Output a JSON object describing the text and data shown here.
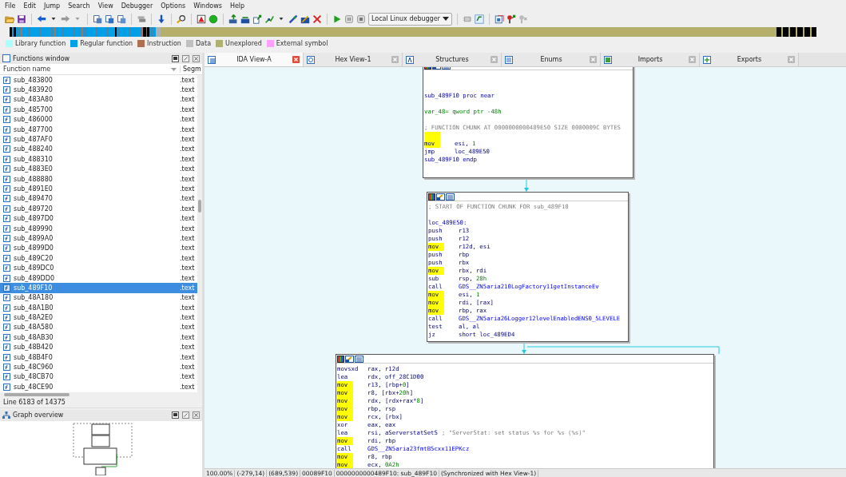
{
  "menu": [
    "File",
    "Edit",
    "Jump",
    "Search",
    "View",
    "Debugger",
    "Options",
    "Windows",
    "Help"
  ],
  "toolbar": {
    "debugger_select": "Local Linux debugger"
  },
  "legend": [
    {
      "label": "Library function",
      "color": "#aaffff"
    },
    {
      "label": "Regular function",
      "color": "#00a0e8"
    },
    {
      "label": "Instruction",
      "color": "#b07050"
    },
    {
      "label": "Data",
      "color": "#c0c0c0"
    },
    {
      "label": "Unexplored",
      "color": "#b0b070"
    },
    {
      "label": "External symbol",
      "color": "#ffa0ff"
    }
  ],
  "functions_window": {
    "title": "Functions window",
    "columns": [
      "Function name",
      "Segm"
    ],
    "rows": [
      {
        "name": "sub_483800",
        "segment": ".text",
        "selected": false
      },
      {
        "name": "sub_483920",
        "segment": ".text",
        "selected": false
      },
      {
        "name": "sub_483A80",
        "segment": ".text",
        "selected": false
      },
      {
        "name": "sub_485700",
        "segment": ".text",
        "selected": false
      },
      {
        "name": "sub_486000",
        "segment": ".text",
        "selected": false
      },
      {
        "name": "sub_487700",
        "segment": ".text",
        "selected": false
      },
      {
        "name": "sub_487AF0",
        "segment": ".text",
        "selected": false
      },
      {
        "name": "sub_488240",
        "segment": ".text",
        "selected": false
      },
      {
        "name": "sub_488310",
        "segment": ".text",
        "selected": false
      },
      {
        "name": "sub_4883E0",
        "segment": ".text",
        "selected": false
      },
      {
        "name": "sub_488880",
        "segment": ".text",
        "selected": false
      },
      {
        "name": "sub_4891E0",
        "segment": ".text",
        "selected": false
      },
      {
        "name": "sub_489470",
        "segment": ".text",
        "selected": false
      },
      {
        "name": "sub_489720",
        "segment": ".text",
        "selected": false
      },
      {
        "name": "sub_4897D0",
        "segment": ".text",
        "selected": false
      },
      {
        "name": "sub_489990",
        "segment": ".text",
        "selected": false
      },
      {
        "name": "sub_4899A0",
        "segment": ".text",
        "selected": false
      },
      {
        "name": "sub_4899D0",
        "segment": ".text",
        "selected": false
      },
      {
        "name": "sub_489C20",
        "segment": ".text",
        "selected": false
      },
      {
        "name": "sub_489DC0",
        "segment": ".text",
        "selected": false
      },
      {
        "name": "sub_489DD0",
        "segment": ".text",
        "selected": false
      },
      {
        "name": "sub_489F10",
        "segment": ".text",
        "selected": true
      },
      {
        "name": "sub_48A180",
        "segment": ".text",
        "selected": false
      },
      {
        "name": "sub_48A1B0",
        "segment": ".text",
        "selected": false
      },
      {
        "name": "sub_48A2E0",
        "segment": ".text",
        "selected": false
      },
      {
        "name": "sub_48A580",
        "segment": ".text",
        "selected": false
      },
      {
        "name": "sub_48AB30",
        "segment": ".text",
        "selected": false
      },
      {
        "name": "sub_48B420",
        "segment": ".text",
        "selected": false
      },
      {
        "name": "sub_48B4F0",
        "segment": ".text",
        "selected": false
      },
      {
        "name": "sub_48C960",
        "segment": ".text",
        "selected": false
      },
      {
        "name": "sub_48CB70",
        "segment": ".text",
        "selected": false
      },
      {
        "name": "sub_48CE90",
        "segment": ".text",
        "selected": false
      }
    ],
    "line_status": "Line 6183 of 14375"
  },
  "graph_overview": {
    "title": "Graph overview"
  },
  "tabs": [
    {
      "label": "IDA View-A",
      "selected": true
    },
    {
      "label": "Hex View-1",
      "selected": false
    },
    {
      "label": "Structures",
      "selected": false
    },
    {
      "label": "Enums",
      "selected": false
    },
    {
      "label": "Imports",
      "selected": false
    },
    {
      "label": "Exports",
      "selected": false
    }
  ],
  "graph": {
    "blocks": [
      {
        "lines": [
          {
            "kind": "label",
            "text": "sub_489F10 proc near"
          },
          {
            "kind": "variable",
            "text": "var_48= qword ptr -48h",
            "gap_before": true
          },
          {
            "kind": "comment",
            "text": "; FUNCTION CHUNK AT 0000000000489E50 SIZE 0000009C BYTES",
            "gap_before": true
          },
          {
            "kind": "instr",
            "mnemonic": "mov",
            "highlighted": true,
            "gap_before": true,
            "operands": [
              {
                "text": "esi, "
              },
              {
                "text": "1",
                "kind": "number"
              }
            ]
          },
          {
            "kind": "instr",
            "mnemonic": "jmp",
            "highlighted": false,
            "operands": [
              {
                "text": "loc_489E50"
              }
            ]
          },
          {
            "kind": "label",
            "text": "sub_489F10 endp"
          }
        ]
      },
      {
        "lines": [
          {
            "kind": "comment",
            "text": "; START OF FUNCTION CHUNK FOR sub_489F10"
          },
          {
            "kind": "label",
            "text": "loc_489E50:",
            "gap_before": true
          },
          {
            "kind": "instr",
            "mnemonic": "push",
            "highlighted": false,
            "operands": [
              {
                "text": "r13"
              }
            ]
          },
          {
            "kind": "instr",
            "mnemonic": "push",
            "highlighted": false,
            "operands": [
              {
                "text": "r12"
              }
            ]
          },
          {
            "kind": "instr",
            "mnemonic": "mov",
            "highlighted": true,
            "operands": [
              {
                "text": "r12d, esi"
              }
            ]
          },
          {
            "kind": "instr",
            "mnemonic": "push",
            "highlighted": false,
            "operands": [
              {
                "text": "rbp"
              }
            ]
          },
          {
            "kind": "instr",
            "mnemonic": "push",
            "highlighted": false,
            "operands": [
              {
                "text": "rbx"
              }
            ]
          },
          {
            "kind": "instr",
            "mnemonic": "mov",
            "highlighted": true,
            "operands": [
              {
                "text": "rbx, rdi"
              }
            ]
          },
          {
            "kind": "instr",
            "mnemonic": "sub",
            "highlighted": false,
            "operands": [
              {
                "text": "rsp, "
              },
              {
                "text": "28h",
                "kind": "number"
              }
            ]
          },
          {
            "kind": "instr",
            "mnemonic": "call",
            "highlighted": false,
            "operands": [
              {
                "text": "GDS__ZN5aria210LogFactory11getInstanceEv",
                "kind": "name"
              }
            ]
          },
          {
            "kind": "instr",
            "mnemonic": "mov",
            "highlighted": true,
            "operands": [
              {
                "text": "esi, "
              },
              {
                "text": "1",
                "kind": "number"
              }
            ]
          },
          {
            "kind": "instr",
            "mnemonic": "mov",
            "highlighted": true,
            "operands": [
              {
                "text": "rdi, [rax]"
              }
            ]
          },
          {
            "kind": "instr",
            "mnemonic": "mov",
            "highlighted": true,
            "operands": [
              {
                "text": "rbp, rax"
              }
            ]
          },
          {
            "kind": "instr",
            "mnemonic": "call",
            "highlighted": false,
            "operands": [
              {
                "text": "GDS__ZN5aria26Logger12levelEnabledENS0_5LEVELE",
                "kind": "name"
              }
            ]
          },
          {
            "kind": "instr",
            "mnemonic": "test",
            "highlighted": false,
            "operands": [
              {
                "text": "al, al"
              }
            ]
          },
          {
            "kind": "instr",
            "mnemonic": "jz",
            "highlighted": false,
            "operands": [
              {
                "text": "short loc_489ED4"
              }
            ]
          }
        ]
      },
      {
        "lines": [
          {
            "kind": "instr",
            "mnemonic": "movsxd",
            "highlighted": false,
            "operands": [
              {
                "text": "rax, r12d"
              }
            ]
          },
          {
            "kind": "instr",
            "mnemonic": "lea",
            "highlighted": false,
            "operands": [
              {
                "text": "rdx, off_28C1D00"
              }
            ]
          },
          {
            "kind": "instr",
            "mnemonic": "mov",
            "highlighted": true,
            "operands": [
              {
                "text": "r13, [rbp+"
              },
              {
                "text": "0",
                "kind": "number"
              },
              {
                "text": "]"
              }
            ]
          },
          {
            "kind": "instr",
            "mnemonic": "mov",
            "highlighted": true,
            "operands": [
              {
                "text": "r8, [rbx+"
              },
              {
                "text": "20h",
                "kind": "number"
              },
              {
                "text": "]"
              }
            ]
          },
          {
            "kind": "instr",
            "mnemonic": "mov",
            "highlighted": true,
            "operands": [
              {
                "text": "rdx, [rdx+rax*"
              },
              {
                "text": "8",
                "kind": "number"
              },
              {
                "text": "]"
              }
            ]
          },
          {
            "kind": "instr",
            "mnemonic": "mov",
            "highlighted": true,
            "operands": [
              {
                "text": "rbp, rsp"
              }
            ]
          },
          {
            "kind": "instr",
            "mnemonic": "mov",
            "highlighted": true,
            "operands": [
              {
                "text": "rcx, [rbx]"
              }
            ]
          },
          {
            "kind": "instr",
            "mnemonic": "xor",
            "highlighted": false,
            "operands": [
              {
                "text": "eax, eax"
              }
            ]
          },
          {
            "kind": "instr",
            "mnemonic": "lea",
            "highlighted": false,
            "operands": [
              {
                "text": "rsi, aServerstatSetS"
              },
              {
                "text": "; \"ServerStat: set status %s for %s (%s)\"",
                "kind": "comment"
              }
            ]
          },
          {
            "kind": "instr",
            "mnemonic": "mov",
            "highlighted": true,
            "operands": [
              {
                "text": "rdi, rbp"
              }
            ]
          },
          {
            "kind": "instr",
            "mnemonic": "call",
            "highlighted": false,
            "operands": [
              {
                "text": "GDS__ZN5aria23fmtB5cxx11EPKcz",
                "kind": "name"
              }
            ]
          },
          {
            "kind": "instr",
            "mnemonic": "mov",
            "highlighted": true,
            "operands": [
              {
                "text": "r8, rbp"
              }
            ]
          },
          {
            "kind": "instr",
            "mnemonic": "mov",
            "highlighted": true,
            "operands": [
              {
                "text": "ecx, "
              },
              {
                "text": "0A2h",
                "kind": "number"
              }
            ]
          }
        ]
      }
    ]
  },
  "status_bar": [
    "100.00%",
    "(-279,14)",
    "(689,539)",
    "00089F10",
    "0000000000489F10: sub_489F10",
    "(Synchronized with Hex View-1)"
  ]
}
